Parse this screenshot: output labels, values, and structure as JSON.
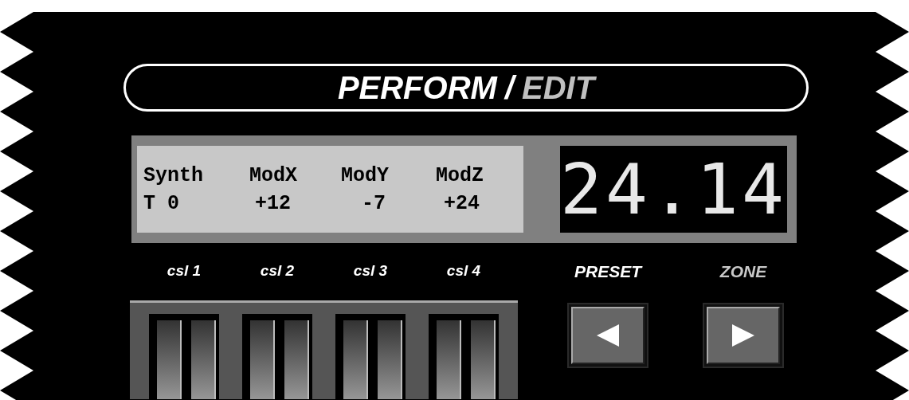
{
  "title": {
    "modes": [
      {
        "label": "PERFORM",
        "selected": true
      },
      {
        "label": "EDIT",
        "selected": false
      }
    ],
    "separator": "/"
  },
  "lcd": {
    "columns": [
      {
        "header": "Synth",
        "value": "T 0"
      },
      {
        "header": "ModX",
        "value": "+12"
      },
      {
        "header": "ModY",
        "value": "-7"
      },
      {
        "header": "ModZ",
        "value": "+24"
      }
    ]
  },
  "led_display": "24.14",
  "sliders": [
    {
      "label": "csl 1"
    },
    {
      "label": "csl 2"
    },
    {
      "label": "csl 3"
    },
    {
      "label": "csl 4"
    }
  ],
  "buttons": [
    {
      "label": "PRESET",
      "selected": true,
      "kind": "left"
    },
    {
      "label": "ZONE",
      "selected": false,
      "kind": "right"
    }
  ]
}
